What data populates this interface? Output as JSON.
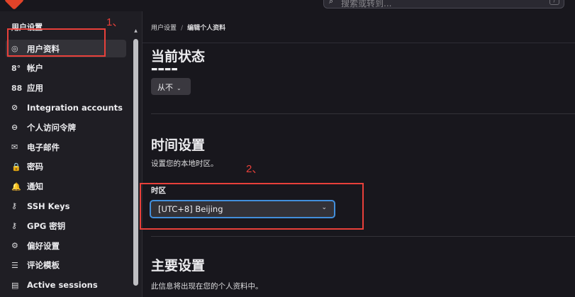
{
  "header": {
    "search_placeholder": "搜索或转到...",
    "kbd_hint": "/"
  },
  "sidebar": {
    "title": "用户设置",
    "items": [
      {
        "label": "用户资料",
        "icon": "user-circle-icon",
        "glyph": "◎",
        "active": true
      },
      {
        "label": "帐户",
        "icon": "account-icon",
        "glyph": "8°",
        "active": false
      },
      {
        "label": "应用",
        "icon": "applications-icon",
        "glyph": "88",
        "active": false
      },
      {
        "label": "Integration accounts",
        "icon": "link-icon",
        "glyph": "⊘",
        "active": false
      },
      {
        "label": "个人访问令牌",
        "icon": "token-icon",
        "glyph": "⊖",
        "active": false
      },
      {
        "label": "电子邮件",
        "icon": "mail-icon",
        "glyph": "✉",
        "active": false
      },
      {
        "label": "密码",
        "icon": "lock-icon",
        "glyph": "🔒",
        "active": false
      },
      {
        "label": "通知",
        "icon": "bell-icon",
        "glyph": "🔔",
        "active": false
      },
      {
        "label": "SSH Keys",
        "icon": "key-icon",
        "glyph": "⚷",
        "active": false
      },
      {
        "label": "GPG 密钥",
        "icon": "gpg-key-icon",
        "glyph": "⚷",
        "active": false
      },
      {
        "label": "偏好设置",
        "icon": "preferences-icon",
        "glyph": "⚙",
        "active": false
      },
      {
        "label": "评论模板",
        "icon": "comment-template-icon",
        "glyph": "☰",
        "active": false
      },
      {
        "label": "Active sessions",
        "icon": "sessions-icon",
        "glyph": "▤",
        "active": false
      }
    ]
  },
  "breadcrumb": {
    "parent": "用户设置",
    "separator": "/",
    "current": "编辑个人资料"
  },
  "status_section": {
    "title": "当前状态",
    "clear_button": "从不"
  },
  "time_section": {
    "title": "时间设置",
    "description": "设置您的本地时区。",
    "timezone_label": "时区",
    "timezone_value": "[UTC+8] Beijing"
  },
  "main_section": {
    "title": "主要设置",
    "description": "此信息将出现在您的个人资料中。"
  },
  "annotations": {
    "first": "1、",
    "second": "2、",
    "color": "#e8403a"
  },
  "colors": {
    "background": "#18171d",
    "sidebar": "#1f1e24",
    "active_item": "#333238",
    "focus_border": "#428fdc",
    "logo": "#e24329"
  }
}
